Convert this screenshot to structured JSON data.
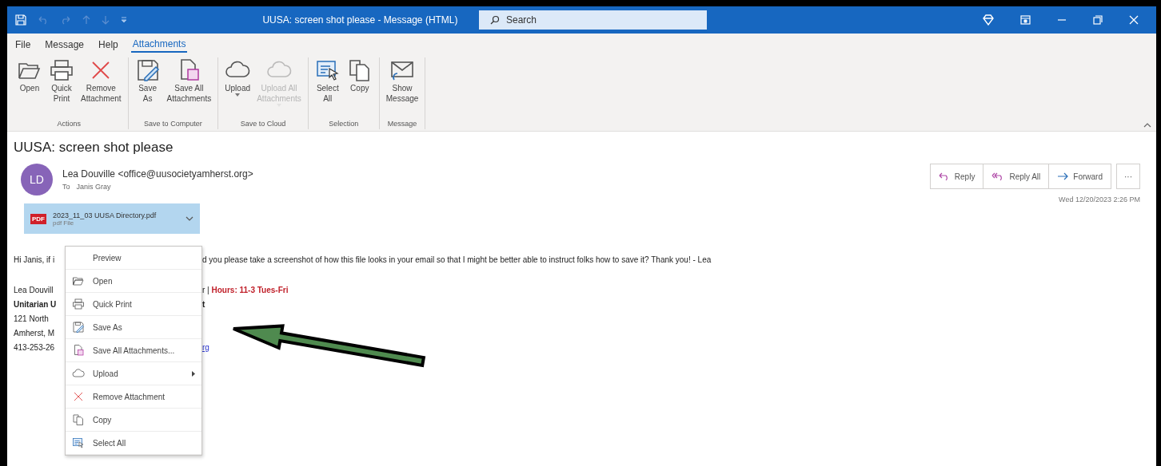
{
  "window": {
    "title": "UUSA: screen shot please  -  Message (HTML)",
    "search": {
      "placeholder": "Search"
    }
  },
  "ribbon": {
    "tabs": [
      {
        "label": "File",
        "selected": false
      },
      {
        "label": "Message",
        "selected": false
      },
      {
        "label": "Help",
        "selected": false
      },
      {
        "label": "Attachments",
        "selected": true
      }
    ],
    "groups": [
      {
        "name": "Actions",
        "buttons": [
          {
            "kind": "open",
            "label": "Open",
            "disabled": false
          },
          {
            "kind": "print",
            "label": "Quick\nPrint",
            "disabled": false
          },
          {
            "kind": "remove",
            "label": "Remove\nAttachment",
            "disabled": false
          }
        ]
      },
      {
        "name": "Save to Computer",
        "buttons": [
          {
            "kind": "saveas",
            "label": "Save\nAs",
            "disabled": false
          },
          {
            "kind": "saveall",
            "label": "Save All\nAttachments",
            "disabled": false
          }
        ]
      },
      {
        "name": "Save to Cloud",
        "buttons": [
          {
            "kind": "upload",
            "label": "Upload",
            "dropdown": true,
            "disabled": false
          },
          {
            "kind": "upload",
            "label": "Upload All\nAttachments",
            "dropdown": true,
            "disabled": true
          }
        ]
      },
      {
        "name": "Selection",
        "buttons": [
          {
            "kind": "selectall",
            "label": "Select\nAll",
            "disabled": false
          },
          {
            "kind": "copy",
            "label": "Copy",
            "disabled": false
          }
        ]
      },
      {
        "name": "Message",
        "buttons": [
          {
            "kind": "message",
            "label": "Show\nMessage",
            "disabled": false
          }
        ]
      }
    ]
  },
  "message": {
    "subject": "UUSA: screen shot please",
    "avatar": "LD",
    "sender": "Lea Douville <office@uusocietyamherst.org>",
    "to_label": "To",
    "recipient": "Janis Gray",
    "actions": [
      {
        "kind": "reply",
        "label": "Reply"
      },
      {
        "kind": "replyall",
        "label": "Reply All"
      },
      {
        "kind": "forward",
        "label": "Forward"
      }
    ],
    "more": "···",
    "date": "Wed 12/20/2023 2:26 PM",
    "attachment": {
      "badge": "PDF",
      "name": "2023_11_03 UUSA Directory.pdf",
      "type": "pdf File"
    },
    "body": [
      {
        "lines": [
          {
            "left": "Hi Janis, if i",
            "right": "d you please take a screenshot of how this file looks in your email so that I might be better able to instruct folks how to save it? Thank you! - Lea",
            "bold": false
          }
        ]
      },
      {
        "lines": [
          {
            "left": "Lea Douvill",
            "right": "r |",
            "highlight": "Hours: 11-3 Tues-Fri",
            "bold": false
          },
          {
            "left": "Unitarian U",
            "right": "t",
            "bold": true
          },
          {
            "left": "121 North",
            "bold": false
          },
          {
            "left": "Amherst, M",
            "bold": false
          },
          {
            "left": "413-253-26",
            "link": "rg",
            "bold": false
          }
        ]
      }
    ]
  },
  "context_menu": [
    {
      "kind": "plain",
      "label": "Preview"
    },
    {
      "kind": "open",
      "label": "Open"
    },
    {
      "kind": "print",
      "label": "Quick Print"
    },
    {
      "kind": "saveas",
      "label": "Save As"
    },
    {
      "kind": "saveall",
      "label": "Save All Attachments..."
    },
    {
      "kind": "upload",
      "label": "Upload",
      "submenu": true
    },
    {
      "kind": "remove",
      "label": "Remove Attachment"
    },
    {
      "kind": "copy",
      "label": "Copy"
    },
    {
      "kind": "selectall",
      "label": "Select All"
    }
  ]
}
